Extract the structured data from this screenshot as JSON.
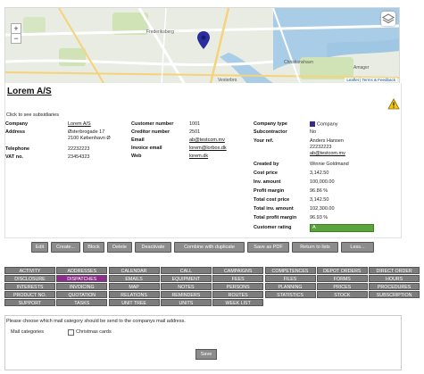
{
  "map": {
    "zoom_in": "+",
    "zoom_out": "−",
    "attribution_leaflet": "Leaflet",
    "attribution_rest": " | Terms & Feedback",
    "labels": [
      "Frederiksberg",
      "Vesterbro",
      "Christianshavn",
      "Amager"
    ]
  },
  "company": {
    "title": "Lorem A/S",
    "subsidiaries_note": "Click to see subsidiaries"
  },
  "left": {
    "company_label": "Company",
    "company_value": "Lorem A/S",
    "address_label": "Address",
    "address_line1": "Østerbrogade 17",
    "address_line2": "2100 København Ø",
    "telephone_label": "Telephone",
    "telephone_value": "22232223",
    "vat_label": "VAT no.",
    "vat_value": "23454323"
  },
  "middle": {
    "customer_number_label": "Customer number",
    "customer_number_value": "1001",
    "creditor_number_label": "Creditor number",
    "creditor_number_value": "2501",
    "email_label": "Email",
    "email_value": "ab@testcom.mv",
    "invoice_email_label": "Invoice email",
    "invoice_email_value": "lorem@lorbox.dk",
    "web_label": "Web",
    "web_value": "lorem.dk"
  },
  "right": {
    "company_type_label": "Company type",
    "company_type_value": "Company",
    "subcontractor_label": "Subcontractor",
    "subcontractor_value": "No",
    "your_ref_label": "Your ref.",
    "your_ref_name": "Anders Hansen",
    "your_ref_phone": "22232223",
    "your_ref_email": "ab@testcom.mv",
    "created_by_label": "Created by",
    "created_by_value": "Winnie Goldmand",
    "cost_price_label": "Cost price",
    "cost_price_value": "3,142.50",
    "inv_amount_label": "Inv. amount",
    "inv_amount_value": "100,000.00",
    "profit_margin_label": "Profit margin",
    "profit_margin_value": "96.86 %",
    "total_cost_label": "Total cost price",
    "total_cost_value": "3,142.50",
    "total_inv_label": "Total inv. amount",
    "total_inv_value": "102,300.00",
    "total_profit_label": "Total profit margin",
    "total_profit_value": "96.93 %",
    "rating_label": "Customer rating",
    "rating_value": "A",
    "rating_color": "#5aa33d"
  },
  "actions": [
    "Edit",
    "Create...",
    "Block",
    "Delete",
    "Deactivate",
    "Combine with duplicate",
    "Save as PDF",
    "Return to lists",
    "Less..."
  ],
  "tabs": [
    [
      "ACTIVITY",
      "ADDRESSES",
      "CALENDAR",
      "CALL",
      "CAMPAIGNS",
      "COMPETENCES",
      "DEPOT ORDERS",
      "DIRECT ORDER"
    ],
    [
      "DISCLOSURE",
      "DISPATCHES",
      "EMAILS",
      "EQUIPMENT",
      "FEES",
      "FILES",
      "FORMS",
      "HOURS"
    ],
    [
      "INTERESTS",
      "INVOICING",
      "MAP",
      "NOTES",
      "PERSONS",
      "PLANNING",
      "PRICES",
      "PROCEDURES"
    ],
    [
      "PRODUCT NO.",
      "QUOTATION",
      "RELATIONS",
      "REMINDERS",
      "ROUTES",
      "STATISTICS",
      "STOCK",
      "SUBSCRIPTION"
    ],
    [
      "SUPPORT",
      "TASKS",
      "UNIT TREE",
      "UNITS",
      "WEEK LIST"
    ]
  ],
  "active_tab": "DISPATCHES",
  "active_tab_color": "#8e2d8f",
  "mail": {
    "note": "Please choose which mail category should be send to the companys mail address.",
    "categories_label": "Mail categories",
    "checkbox_label": "Christmas cards",
    "checkbox_checked": false,
    "save_label": "Save"
  }
}
